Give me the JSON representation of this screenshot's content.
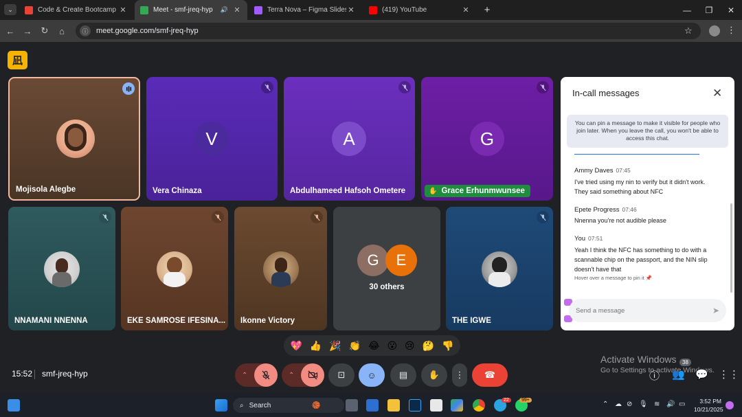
{
  "browser": {
    "tabs": [
      {
        "title": "Code & Create Bootcamp Care",
        "favicon_color": "#ea4335"
      },
      {
        "title": "Meet - smf-jreq-hyp",
        "favicon_color": "#34a853"
      },
      {
        "title": "Terra Nova – Figma Slides",
        "favicon_color": "#a259ff"
      },
      {
        "title": "(419) YouTube",
        "favicon_color": "#ff0000"
      }
    ],
    "url": "meet.google.com/smf-jreq-hyp"
  },
  "meet": {
    "logo": "凪",
    "tiles": [
      {
        "name": "Mojisola Alegbe"
      },
      {
        "name": "Vera Chinaza",
        "initial": "V"
      },
      {
        "name": "Abdulhameed Hafsoh Ometere",
        "initial": "A"
      },
      {
        "name": "Grace Erhunmwunsee",
        "initial": "G"
      },
      {
        "name": "NNAMANI NNENNA"
      },
      {
        "name": "EKE SAMROSE IFESINA..."
      },
      {
        "name": "Ikonne Victory"
      },
      {
        "others_label": "30 others",
        "initials": [
          "G",
          "E"
        ]
      },
      {
        "name": "THE IGWE"
      }
    ],
    "chat": {
      "title": "In-call messages",
      "pin_note": "You can pin a message to make it visible for people who join later. When you leave the call, you won't be able to access this chat.",
      "messages": [
        {
          "sender": "Ammy Daves",
          "time": "07:45",
          "text": "I've tried using my nin to verify but it didn't work. They said something about NFC"
        },
        {
          "sender": "Epete Progress",
          "time": "07:46",
          "text": "Nnenna you're not audible please"
        },
        {
          "sender": "You",
          "time": "07:51",
          "text": "Yeah I think the NFC has something to do with a scannable chip on the passport, and the NIN slip doesn't have that"
        }
      ],
      "hover_tip": "Hover over a message to pin it",
      "placeholder": "Send a message"
    },
    "reactions": [
      "💖",
      "👍",
      "🎉",
      "👏",
      "😂",
      "😮",
      "😢",
      "🤔",
      "👎"
    ],
    "clock": "15:52",
    "meeting_code": "smf-jreq-hyp",
    "people_count": "38"
  },
  "windows": {
    "activate_title": "Activate Windows",
    "activate_sub": "Go to Settings to activate Windows.",
    "search_label": "Search",
    "time": "3:52 PM",
    "date": "10/21/2025",
    "notif_badge": "99+",
    "telegram_badge": "22"
  }
}
